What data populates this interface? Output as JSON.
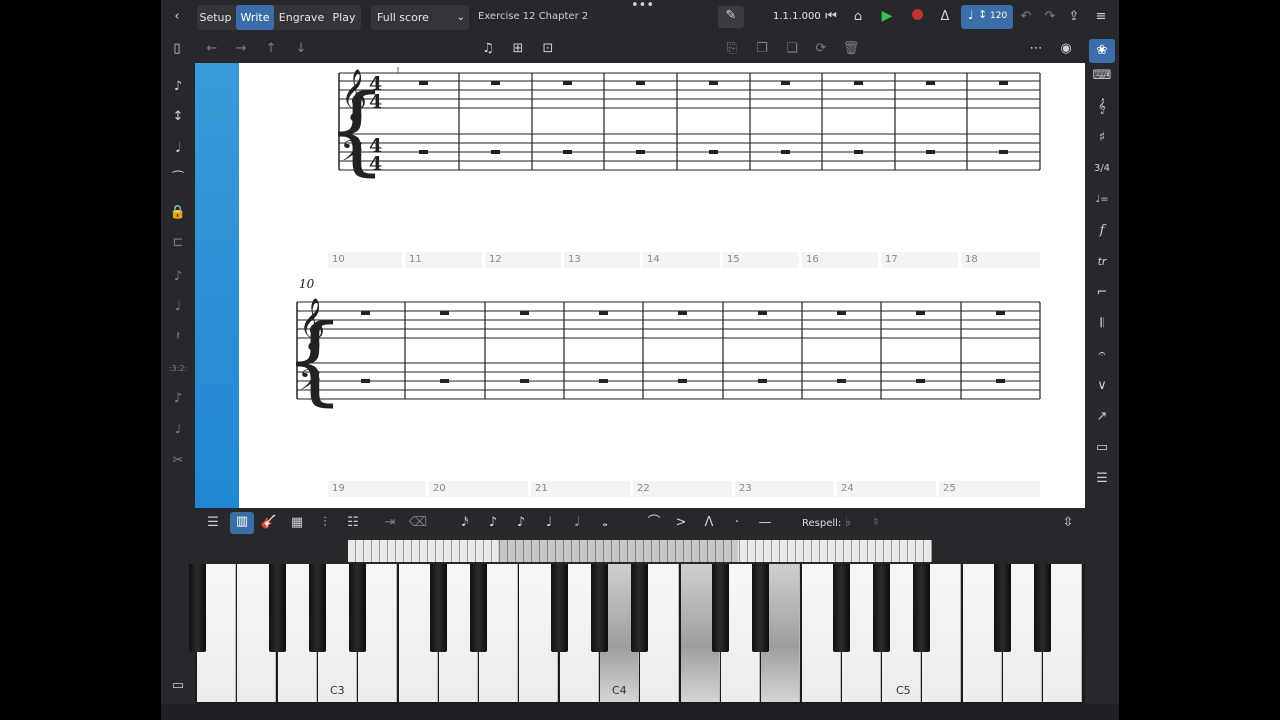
{
  "topbar": {
    "back_icon": "chevron-left-icon",
    "modes": [
      "Setup",
      "Write",
      "Engrave",
      "Play"
    ],
    "active_mode": "Write",
    "layout_selector": "Full score",
    "project_title": "Exercise 12 Chapter 2",
    "position": "1.1.1.000",
    "tempo": "120"
  },
  "lower_toolbar": {
    "respell_label": "Respell:"
  },
  "score": {
    "system2_start_bar": "10",
    "bar_numbers_row1": [
      "10",
      "11",
      "12",
      "13",
      "14",
      "15",
      "16",
      "17",
      "18"
    ],
    "bar_numbers_row2": [
      "19",
      "20",
      "21",
      "22",
      "23",
      "24",
      "25"
    ]
  },
  "keyboard": {
    "labels": [
      "C3",
      "C4",
      "C5"
    ]
  },
  "colors": {
    "accent": "#3b6ea8",
    "play": "#36c24a",
    "record": "#c43131",
    "score_blue": "#2a91d6"
  }
}
